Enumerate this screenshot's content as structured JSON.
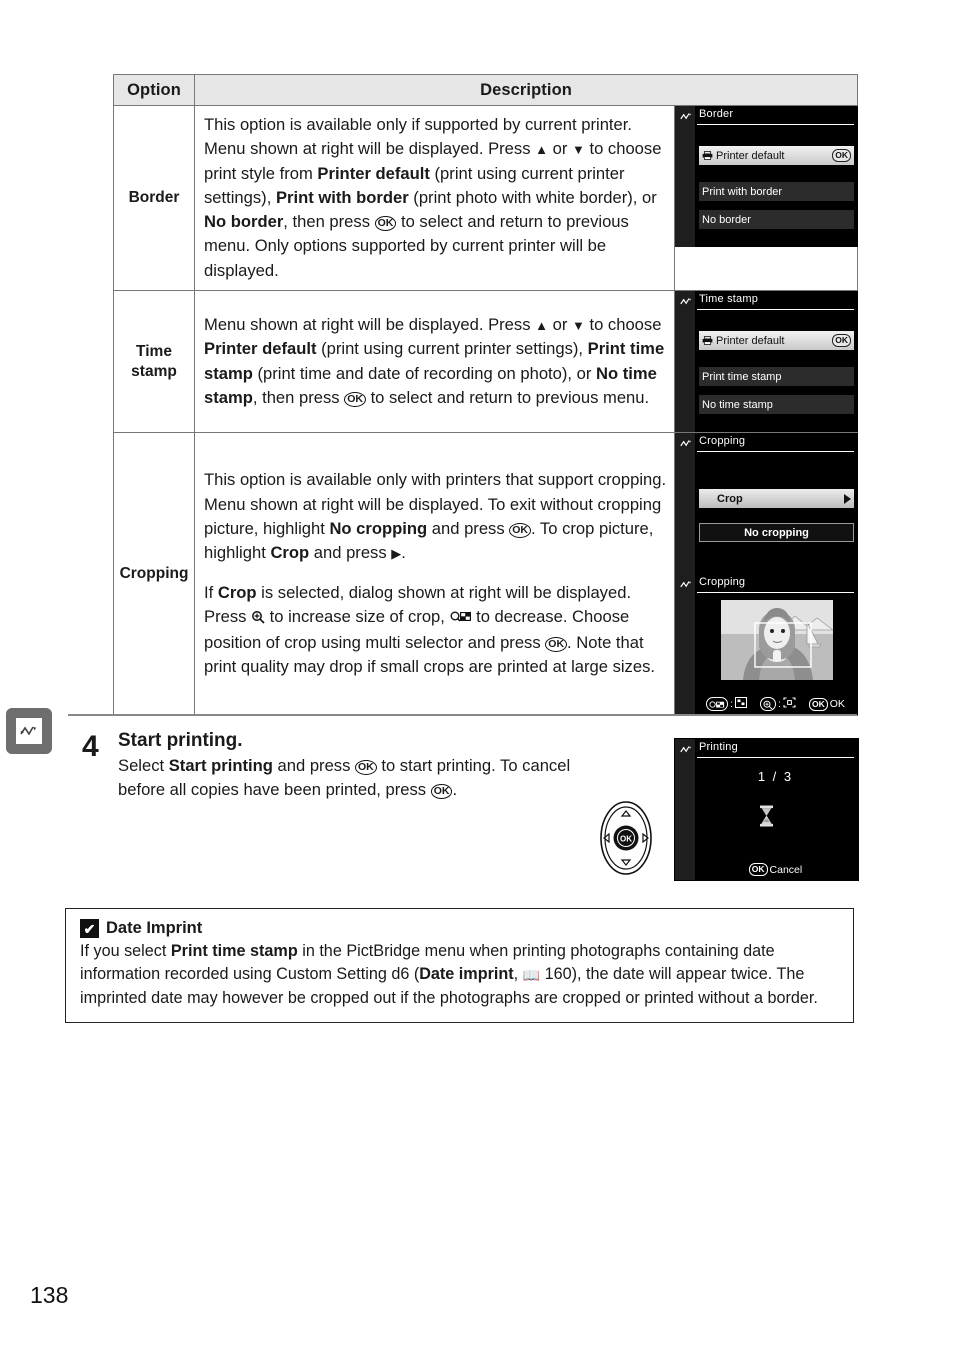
{
  "page": {
    "number": "138"
  },
  "edge_tab": {
    "icon": "connection-zigzag-icon"
  },
  "table": {
    "headers": {
      "option": "Option",
      "description": "Description"
    },
    "rows": [
      {
        "option": "Border",
        "description_parts": [
          "This option is available only if supported by current printer.  Menu shown at right will be displayed.  Press ",
          " or ",
          " to choose print style from ",
          "Printer default",
          " (print using current printer settings), ",
          "Print with border",
          " (print photo with white border), or ",
          "No border",
          ", then press ",
          " to select and return to previous menu.  Only options supported by current printer will be displayed."
        ],
        "screen": {
          "title": "Border",
          "items": [
            {
              "label": "Printer default",
              "printer_icon": true,
              "ok_badge": "OK",
              "state": "selected"
            },
            {
              "label": "Print with border",
              "printer_icon": false,
              "state": "dim"
            },
            {
              "label": "No border",
              "printer_icon": false,
              "state": "dim"
            }
          ]
        }
      },
      {
        "option": "Time stamp",
        "description_parts": [
          "Menu shown at right will be displayed.  Press ",
          " or ",
          " to choose ",
          "Printer default",
          " (print using current printer settings), ",
          "Print time stamp",
          " (print time and date of recording on photo), or ",
          "No time stamp",
          ", then press ",
          " to select and return to previous menu."
        ],
        "screen": {
          "title": "Time stamp",
          "items": [
            {
              "label": "Printer default",
              "printer_icon": true,
              "ok_badge": "OK",
              "state": "selected"
            },
            {
              "label": "Print time stamp",
              "printer_icon": false,
              "state": "dim"
            },
            {
              "label": "No time stamp",
              "printer_icon": false,
              "state": "dim"
            }
          ]
        }
      },
      {
        "option": "Cropping",
        "description_para1": [
          "This option is available only with printers that support cropping.  Menu shown at right will be displayed.  To exit without cropping picture, highlight ",
          "No cropping",
          " and press ",
          ".  To crop picture, highlight ",
          "Crop",
          " and press ",
          "."
        ],
        "description_para2": [
          "If ",
          "Crop",
          " is selected, dialog shown at right will be displayed.  Press ",
          " to increase size of crop, ",
          " to decrease.  Choose position of crop using multi selector and press ",
          ".  Note that print quality may drop if small crops are printed at large sizes."
        ],
        "screen_menu": {
          "title": "Cropping",
          "items": [
            {
              "label": "Crop",
              "state": "selected",
              "arrow": "right-arrow-icon"
            },
            {
              "label": "No cropping",
              "state": "outlined"
            }
          ]
        },
        "screen_crop": {
          "title": "Cropping",
          "bottom_bar": {
            "zoom_out_label": "thumbnail-grid-icon",
            "zoom_in_label": "crop-frame-icon",
            "ok_badge": "OK",
            "ok_label": "OK"
          }
        }
      }
    ]
  },
  "step4": {
    "number": "4",
    "title": "Start printing.",
    "text_parts": [
      "Select ",
      "Start printing",
      " and press ",
      " to start printing.  To cancel before all copies have been printed, press ",
      "."
    ],
    "multi_selector": {
      "center_label": "OK"
    },
    "screen": {
      "title": "Printing",
      "count": "1 / 3",
      "icon": "hourglass-icon",
      "cancel_badge": "OK",
      "cancel_label": "Cancel"
    }
  },
  "caution": {
    "mark": "✔",
    "title": "Date Imprint",
    "text_parts": [
      "If you select ",
      "Print time stamp",
      " in the PictBridge menu when printing photographs containing date information recorded using Custom Setting d6 (",
      "Date imprint",
      ", ",
      " 160), the date will appear twice.   The imprinted date may however be cropped out if the photographs are cropped or printed without a border."
    ],
    "page_ref": "160"
  },
  "glyphs": {
    "ok": "OK",
    "triangle_up": "▲",
    "triangle_down": "▼",
    "triangle_right": "▶"
  }
}
